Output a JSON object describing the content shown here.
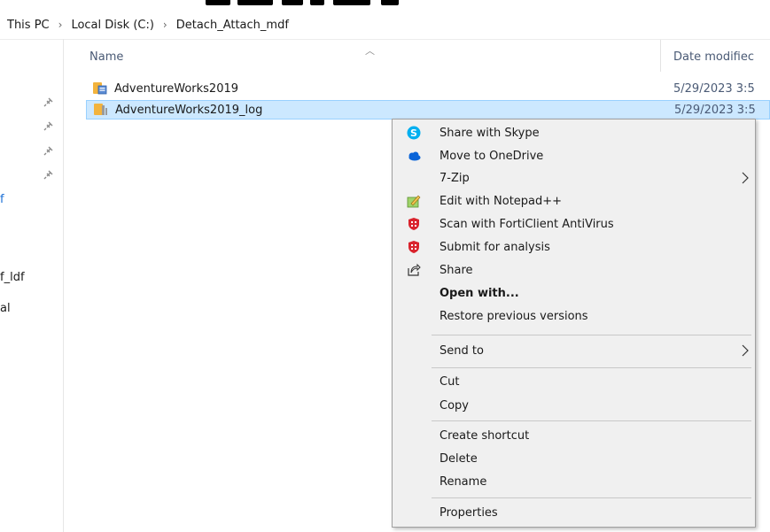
{
  "breadcrumb": {
    "items": [
      "This PC",
      "Local Disk (C:)",
      "Detach_Attach_mdf"
    ],
    "separator": "›"
  },
  "nav_fragments": {
    "f": "f",
    "f_ldf": "f_ldf",
    "al": "al"
  },
  "columns": {
    "name": "Name",
    "date_modified": "Date modifiec"
  },
  "files": [
    {
      "name": "AdventureWorks2019",
      "date": "5/29/2023 3:5",
      "icon": "database-file-icon",
      "selected": false
    },
    {
      "name": "AdventureWorks2019_log",
      "date": "5/29/2023 3:5",
      "icon": "log-file-icon",
      "selected": true
    }
  ],
  "context_menu": {
    "share_skype": "Share with Skype",
    "move_onedrive": "Move to OneDrive",
    "seven_zip": "7-Zip",
    "edit_notepad": "Edit with Notepad++",
    "scan_forti": "Scan with FortiClient AntiVirus",
    "submit_analysis": "Submit for analysis",
    "share": "Share",
    "open_with": "Open with...",
    "restore": "Restore previous versions",
    "send_to": "Send to",
    "cut": "Cut",
    "copy": "Copy",
    "create_shortcut": "Create shortcut",
    "delete": "Delete",
    "rename": "Rename",
    "properties": "Properties"
  },
  "colors": {
    "selection_bg": "#cce8ff",
    "selection_border": "#99d1ff",
    "menu_bg": "#f0f0f0",
    "skype": "#00aff0",
    "onedrive": "#0a64d8",
    "forti": "#d9232d"
  }
}
